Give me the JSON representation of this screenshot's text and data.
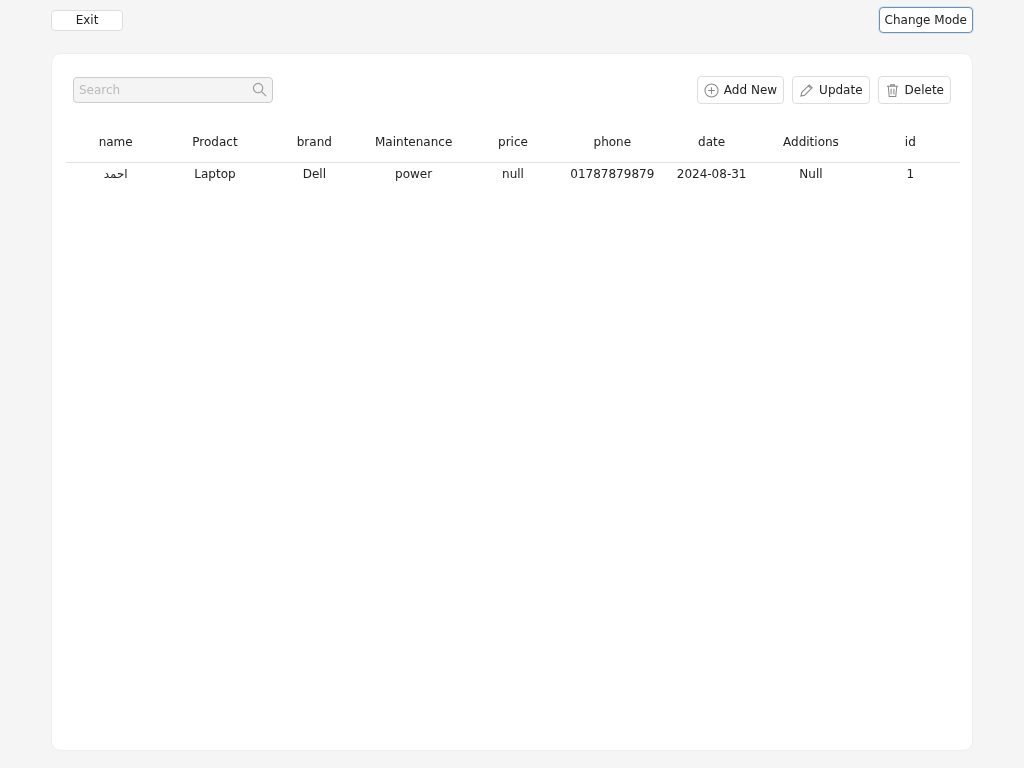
{
  "top_bar": {
    "exit_button": "Exit",
    "change_mode_button": {
      "label": "Change Mode",
      "focused": true
    }
  },
  "search": {
    "placeholder": "Search"
  },
  "actions": [
    {
      "kind": "add",
      "label": "Add New"
    },
    {
      "kind": "edit",
      "label": "Update"
    },
    {
      "kind": "delete",
      "label": "Delete"
    }
  ],
  "table": {
    "columns": [
      "name",
      "Prodact",
      "brand",
      "Maintenance",
      "price",
      "phone",
      "date",
      "Additions",
      "id"
    ],
    "rows": [
      [
        "احمد",
        "Laptop",
        "Dell",
        "power",
        "null",
        "01787879879",
        "2024-08-31",
        "Null",
        "1"
      ]
    ]
  }
}
